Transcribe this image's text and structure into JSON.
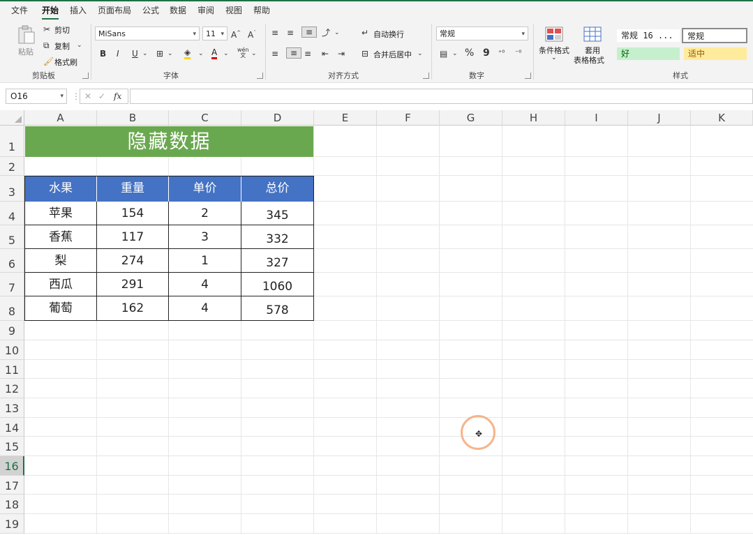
{
  "menu": {
    "tabs": [
      "文件",
      "开始",
      "插入",
      "页面布局",
      "公式",
      "数据",
      "审阅",
      "视图",
      "帮助"
    ],
    "active_index": 1
  },
  "ribbon": {
    "clipboard": {
      "paste": "粘贴",
      "cut": "剪切",
      "copy": "复制",
      "format_painter": "格式刷",
      "label": "剪贴板"
    },
    "font": {
      "name": "MiSans",
      "size": "11",
      "label": "字体",
      "bold": "B",
      "italic": "I",
      "underline": "U",
      "phonetic": "wén"
    },
    "alignment": {
      "wrap_text": "自动换行",
      "merge_center": "合并后居中",
      "label": "对齐方式"
    },
    "number": {
      "format": "常规",
      "percent": "%",
      "comma": "9",
      "label": "数字"
    },
    "styles": {
      "conditional": "条件格式",
      "table_format_1": "套用",
      "table_format_2": "表格格式",
      "normal16": "常规 16 ...",
      "normal": "常规",
      "good": "好",
      "neutral": "适中",
      "label": "样式"
    }
  },
  "formula_bar": {
    "name_box": "O16",
    "fx": "fx",
    "value": ""
  },
  "sheet": {
    "columns": [
      "A",
      "B",
      "C",
      "D",
      "E",
      "F",
      "G",
      "H",
      "I",
      "J",
      "K"
    ],
    "rows": [
      "1",
      "2",
      "3",
      "4",
      "5",
      "6",
      "7",
      "8",
      "9",
      "10",
      "11",
      "12",
      "13",
      "14",
      "15",
      "16",
      "17",
      "18",
      "19"
    ],
    "selected_row": "16",
    "title": "隐藏数据",
    "table_headers": [
      "水果",
      "重量",
      "单价",
      "总价"
    ],
    "table_rows": [
      [
        "苹果",
        "154",
        "2",
        "345"
      ],
      [
        "香蕉",
        "117",
        "3",
        "332"
      ],
      [
        "梨",
        "274",
        "1",
        "327"
      ],
      [
        "西瓜",
        "291",
        "4",
        "1060"
      ],
      [
        "葡萄",
        "162",
        "4",
        "578"
      ]
    ]
  },
  "colors": {
    "accent": "#1e7145",
    "title_fill": "#6aa84f",
    "header_fill": "#4472c4",
    "good_fill": "#c6efce",
    "neutral_fill": "#ffeb9c",
    "cursor_ring": "#f5b48c"
  }
}
